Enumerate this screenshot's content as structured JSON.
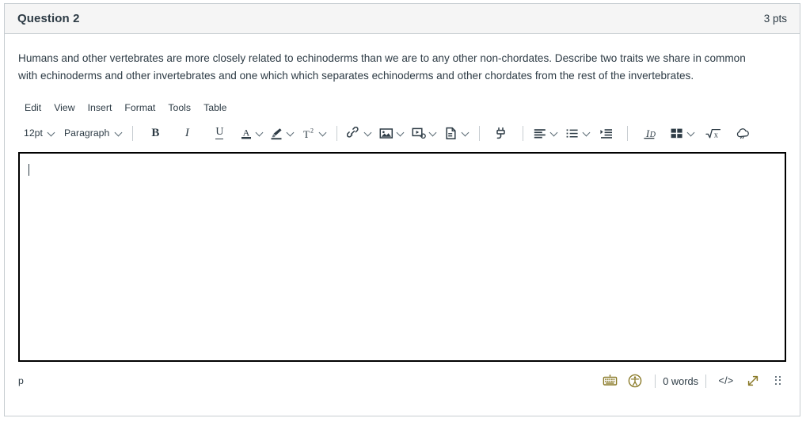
{
  "header": {
    "title": "Question 2",
    "points": "3 pts"
  },
  "question": {
    "text": "Humans and other vertebrates are more closely related to echinoderms than we are to any other non-chordates. Describe two traits we share in common with echinoderms and other invertebrates and one which which separates echinoderms and other chordates from the rest of the invertebrates."
  },
  "menubar": {
    "items": [
      {
        "label": "Edit",
        "name": "menu-edit"
      },
      {
        "label": "View",
        "name": "menu-view"
      },
      {
        "label": "Insert",
        "name": "menu-insert"
      },
      {
        "label": "Format",
        "name": "menu-format"
      },
      {
        "label": "Tools",
        "name": "menu-tools"
      },
      {
        "label": "Table",
        "name": "menu-table"
      }
    ]
  },
  "toolbar": {
    "font_size": "12pt",
    "block_format": "Paragraph",
    "bold": "B",
    "italic": "I",
    "underline": "U",
    "text_color": "A",
    "superscript": "T",
    "superscript_exp": "2",
    "math": "√x",
    "icons": {
      "font_size_select": "font-size-select",
      "block_format_select": "block-format-select",
      "bold": "bold-icon",
      "italic": "italic-icon",
      "underline": "underline-icon",
      "text_color": "text-color-icon",
      "highlight_color": "highlight-color-icon",
      "superscript": "superscript-icon",
      "link": "link-icon",
      "image": "image-icon",
      "media": "media-icon",
      "document": "document-icon",
      "apps": "apps-plug-icon",
      "align": "align-left-icon",
      "list": "bulleted-list-icon",
      "indent": "increase-indent-icon",
      "clear_formatting": "clear-formatting-icon",
      "table": "table-icon",
      "math": "math-equation-icon",
      "cloud": "cloud-upload-icon"
    }
  },
  "editor": {
    "content": "",
    "placeholder": ""
  },
  "status": {
    "element_path": "p",
    "word_count": "0 words",
    "html_editor": "</>",
    "icons": {
      "keyboard": "keyboard-shortcuts-icon",
      "accessibility": "accessibility-checker-icon",
      "html_editor": "html-editor-icon",
      "resize": "resize-expand-icon",
      "drag_handle": "drag-handle-icon"
    }
  },
  "colors": {
    "header_bg": "#f5f5f5",
    "border": "#c7cdd1",
    "text": "#2d3b45",
    "editor_border": "#000000",
    "accent_olive": "#8a7a28"
  }
}
